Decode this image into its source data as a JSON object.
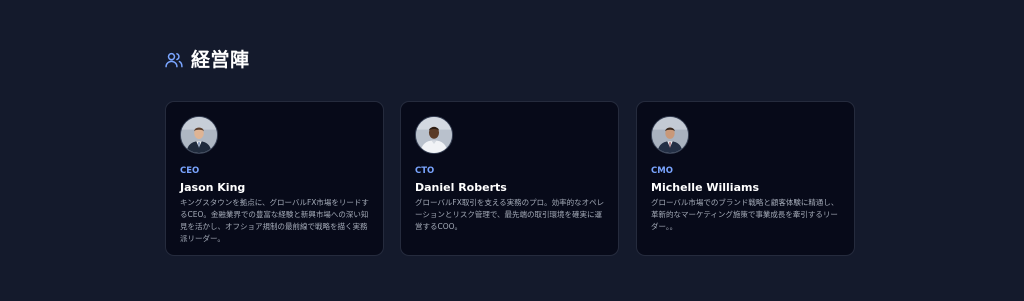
{
  "section": {
    "title": "経営陣",
    "icon": "users-icon",
    "accent_color": "#7aa5ff"
  },
  "team": [
    {
      "role": "CEO",
      "name": "Jason King",
      "bio": "キングスタウンを拠点に、グローバルFX市場をリードするCEO。金融業界での豊富な経験と新興市場への深い知見を活かし、オフショア規制の最前線で戦略を描く実務派リーダー。",
      "avatar": "avatar-photo"
    },
    {
      "role": "CTO",
      "name": "Daniel Roberts",
      "bio": "グローバルFX取引を支える実務のプロ。効率的なオペレーションとリスク管理で、最先端の取引環境を確実に運営するCOO。",
      "avatar": "avatar-photo"
    },
    {
      "role": "CMO",
      "name": "Michelle Williams",
      "bio": "グローバル市場でのブランド戦略と顧客体験に精通し、革新的なマーケティング施策で事業成長を牽引するリーダー。。",
      "avatar": "avatar-photo"
    }
  ]
}
